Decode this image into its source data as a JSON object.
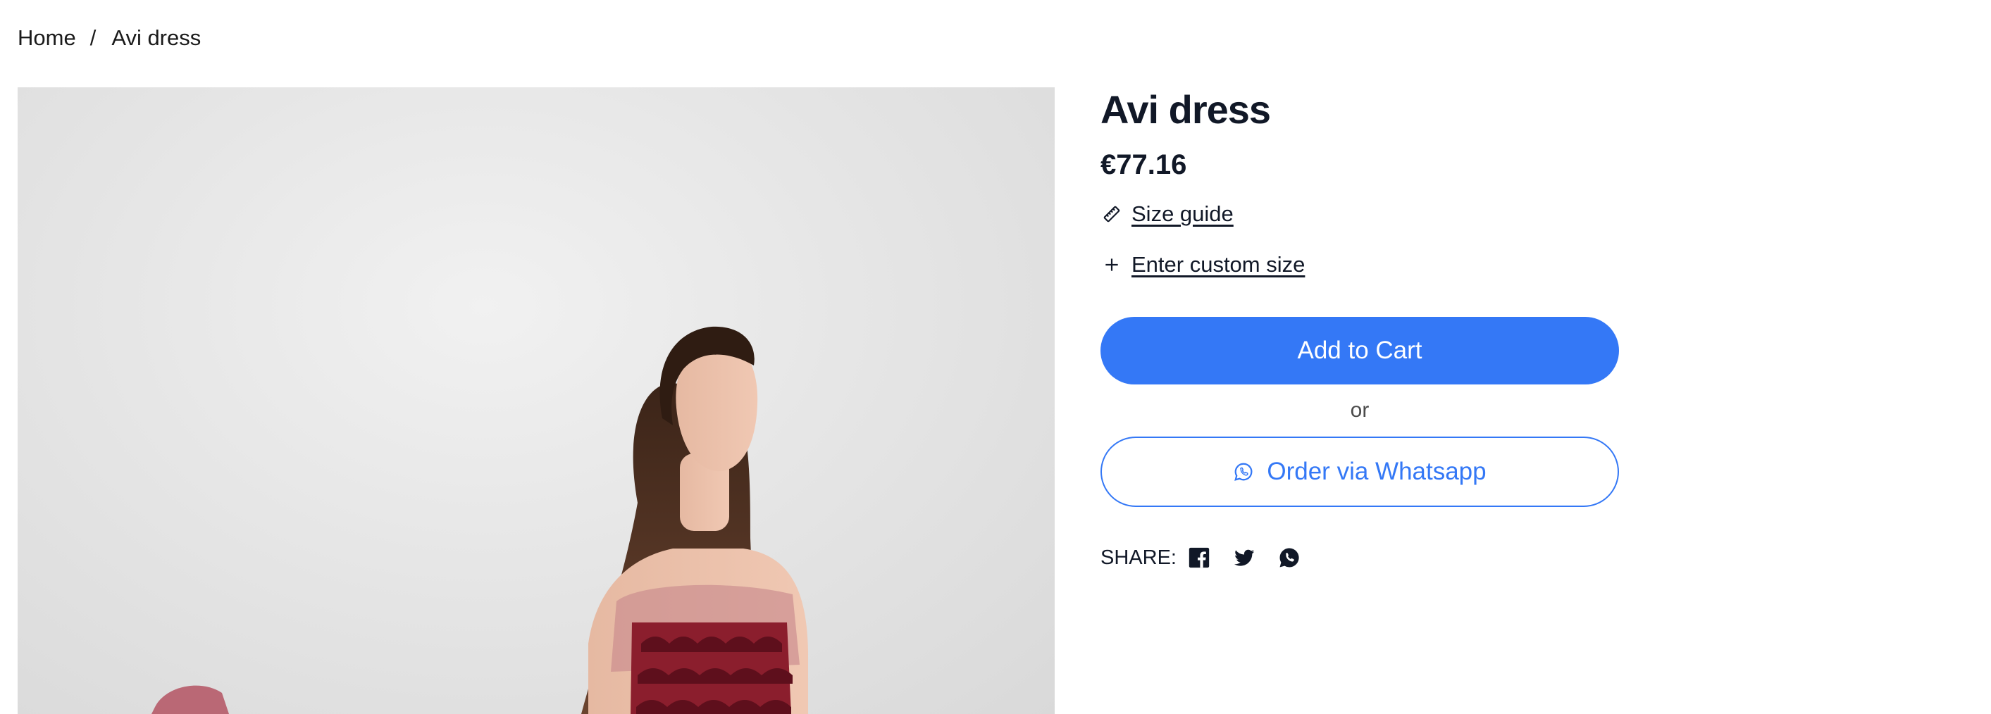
{
  "breadcrumb": {
    "home": "Home",
    "separator": "/",
    "current": "Avi dress"
  },
  "product": {
    "title": "Avi dress",
    "price": "€77.16",
    "size_guide_label": "Size guide",
    "custom_size_label": "Enter custom size",
    "add_to_cart_label": "Add to Cart",
    "or_label": "or",
    "whatsapp_order_label": "Order via Whatsapp",
    "share_label": "SHARE:"
  },
  "icons": {
    "size_guide": "ruler-icon",
    "custom_size": "plus-icon",
    "whatsapp_button": "whatsapp-icon",
    "share": [
      "facebook-icon",
      "twitter-icon",
      "whatsapp-icon"
    ]
  },
  "colors": {
    "accent": "#3478f6",
    "text": "#111827",
    "dress": "#8b1e2d"
  }
}
